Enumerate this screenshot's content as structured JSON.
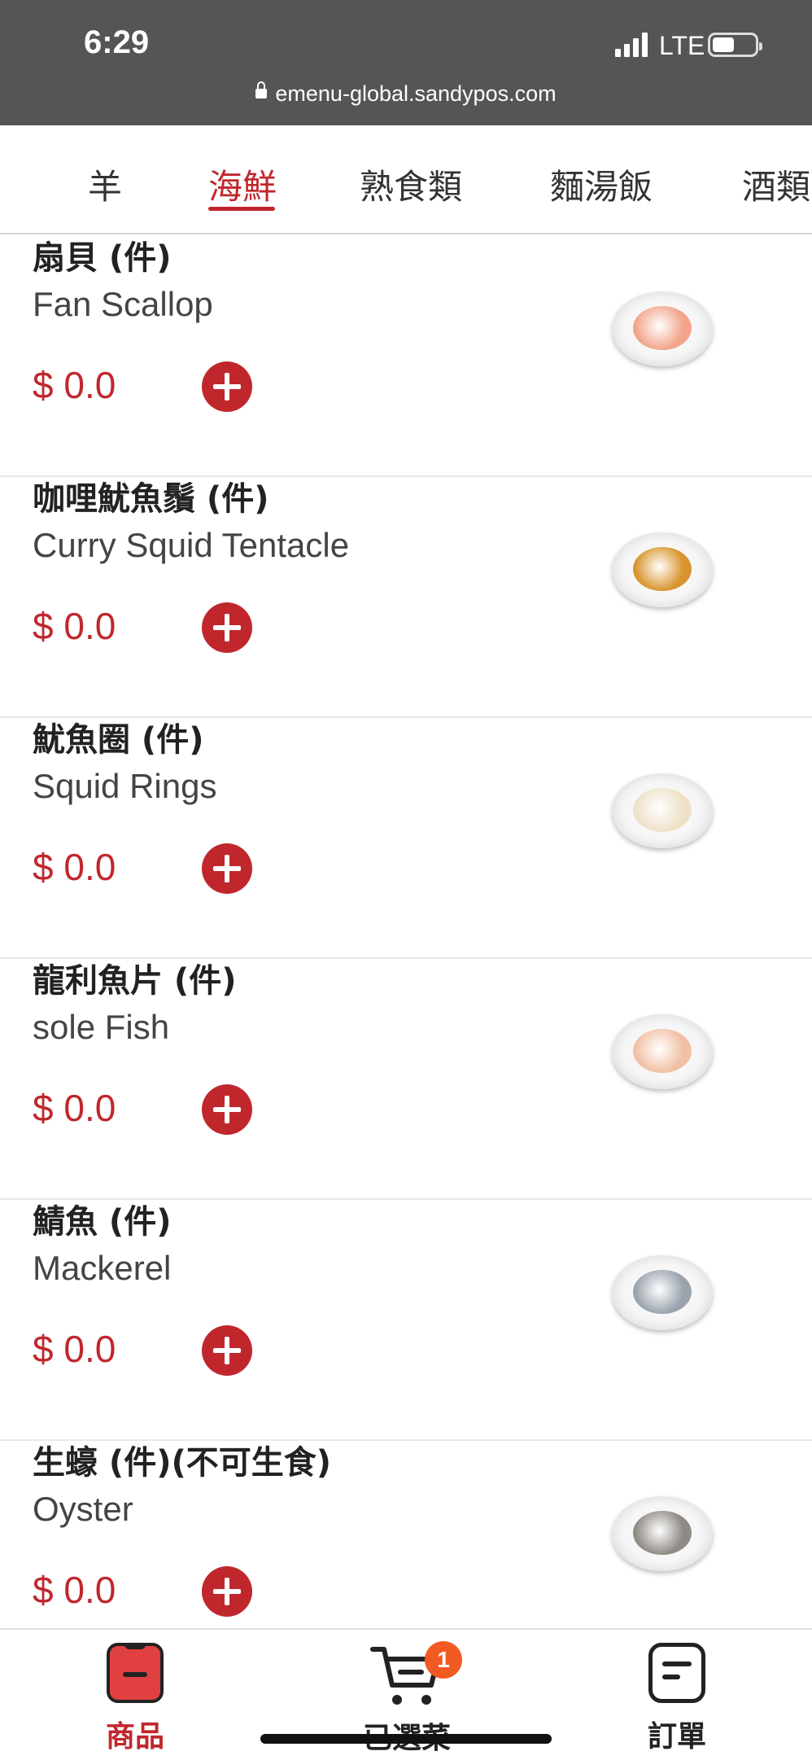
{
  "status": {
    "time": "6:29",
    "network": "LTE"
  },
  "browser": {
    "url": "emenu-global.sandypos.com"
  },
  "tabs": [
    {
      "label": "羊",
      "active": false
    },
    {
      "label": "海鮮",
      "active": true
    },
    {
      "label": "熟食類",
      "active": false
    },
    {
      "label": "麵湯飯",
      "active": false
    },
    {
      "label": "酒類",
      "active": false
    }
  ],
  "items": [
    {
      "name_zh": "扇貝 (件)",
      "name_en": "Fan Scallop",
      "price": "$ 0.0",
      "food_color": "#f2a58a"
    },
    {
      "name_zh": "咖哩魷魚鬚 (件)",
      "name_en": "Curry Squid Tentacle",
      "price": "$ 0.0",
      "food_color": "#d8952f"
    },
    {
      "name_zh": "魷魚圈 (件)",
      "name_en": "Squid Rings",
      "price": "$ 0.0",
      "food_color": "#eee1c8"
    },
    {
      "name_zh": "龍利魚片 (件)",
      "name_en": "sole Fish",
      "price": "$ 0.0",
      "food_color": "#f1c0a5"
    },
    {
      "name_zh": "鯖魚 (件)",
      "name_en": "Mackerel",
      "price": "$ 0.0",
      "food_color": "#9aa3ad"
    },
    {
      "name_zh": "生蠔 (件)(不可生食)",
      "name_en": "Oyster",
      "price": "$ 0.0",
      "food_color": "#8f8a84"
    }
  ],
  "bottom_nav": {
    "products": "商品",
    "cart": "已選菜",
    "orders": "訂單",
    "cart_count": "1"
  },
  "colors": {
    "accent": "#c0272d",
    "badge": "#f15a22",
    "statusbar": "#555555"
  }
}
